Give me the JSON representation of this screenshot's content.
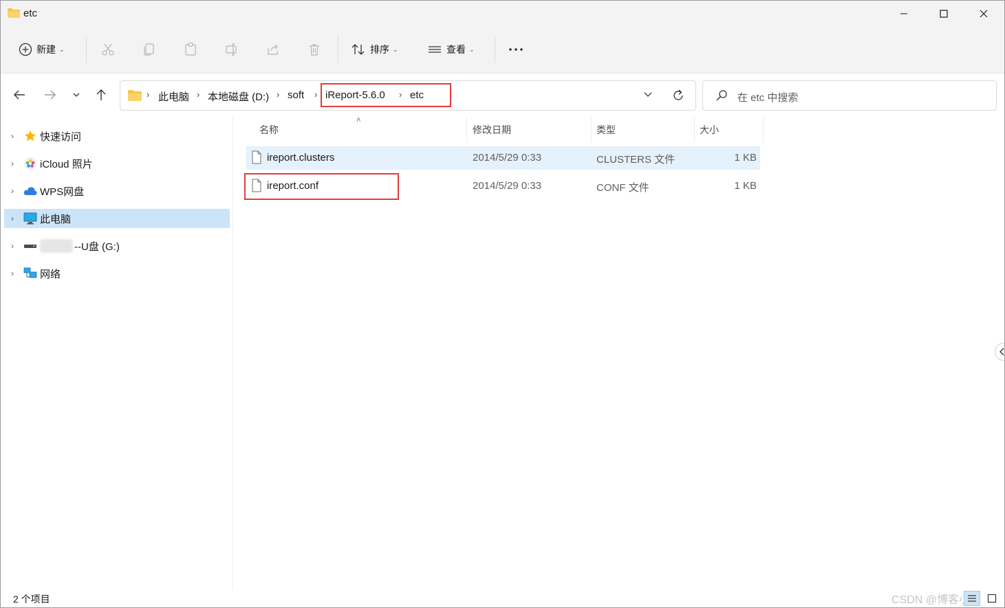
{
  "window": {
    "title": "etc"
  },
  "toolbar": {
    "new_label": "新建",
    "sort_label": "排序",
    "view_label": "查看"
  },
  "address": {
    "crumbs": [
      "此电脑",
      "本地磁盘 (D:)",
      "soft",
      "iReport-5.6.0",
      "etc"
    ]
  },
  "search": {
    "placeholder": "在 etc 中搜索"
  },
  "sidebar": {
    "items": [
      {
        "label": "快速访问",
        "icon": "star-icon"
      },
      {
        "label": "iCloud 照片",
        "icon": "icloud-photos-icon"
      },
      {
        "label": "WPS网盘",
        "icon": "cloud-icon"
      },
      {
        "label": "此电脑",
        "icon": "computer-icon",
        "selected": true
      },
      {
        "label": "--U盘 (G:)",
        "icon": "usb-drive-icon"
      },
      {
        "label": "网络",
        "icon": "network-icon"
      }
    ]
  },
  "columns": {
    "name": "名称",
    "modified": "修改日期",
    "type": "类型",
    "size": "大小"
  },
  "files": [
    {
      "name": "ireport.clusters",
      "modified": "2014/5/29 0:33",
      "type": "CLUSTERS 文件",
      "size": "1 KB",
      "selected": true
    },
    {
      "name": "ireport.conf",
      "modified": "2014/5/29 0:33",
      "type": "CONF 文件",
      "size": "1 KB",
      "selected": false
    }
  ],
  "status": {
    "count": "2 个项目"
  },
  "watermark": "CSDN @博客小沙",
  "colors": {
    "accent_red": "#e03c3c",
    "selection": "#cce4f7",
    "row_selected": "#e5f1fb",
    "folder": "#f6c549"
  }
}
